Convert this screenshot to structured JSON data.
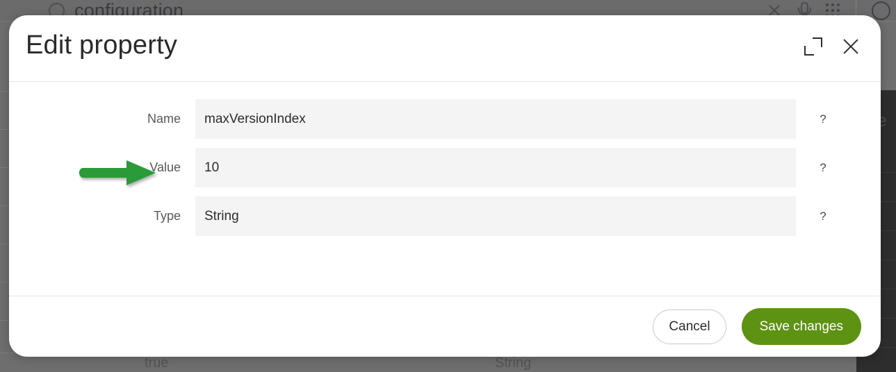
{
  "background": {
    "search": {
      "icon": "search-icon",
      "value": "configuration"
    },
    "toolbar_icons": [
      "close-icon",
      "microphone-icon",
      "apps-grid-icon",
      "avatar"
    ],
    "table_cells": [
      {
        "text": "true"
      },
      {
        "text": "String"
      }
    ],
    "side_panel_text": "ope"
  },
  "dialog": {
    "title": "Edit property",
    "maximize_icon": "maximize-icon",
    "close_icon": "close-icon",
    "fields": [
      {
        "label": "Name",
        "value": "maxVersionIndex",
        "help": "?"
      },
      {
        "label": "Value",
        "value": "10",
        "help": "?"
      },
      {
        "label": "Type",
        "value": "String",
        "help": "?"
      }
    ],
    "footer": {
      "cancel_label": "Cancel",
      "save_label": "Save changes"
    }
  },
  "annotation": {
    "arrow_color": "#2a9b37",
    "arrow_points_to": "Value"
  },
  "colors": {
    "accent_green": "#5d9212",
    "annotation_green": "#2a9b37",
    "field_background": "#f4f4f4",
    "overlay_dim": "#6e6e6e"
  }
}
